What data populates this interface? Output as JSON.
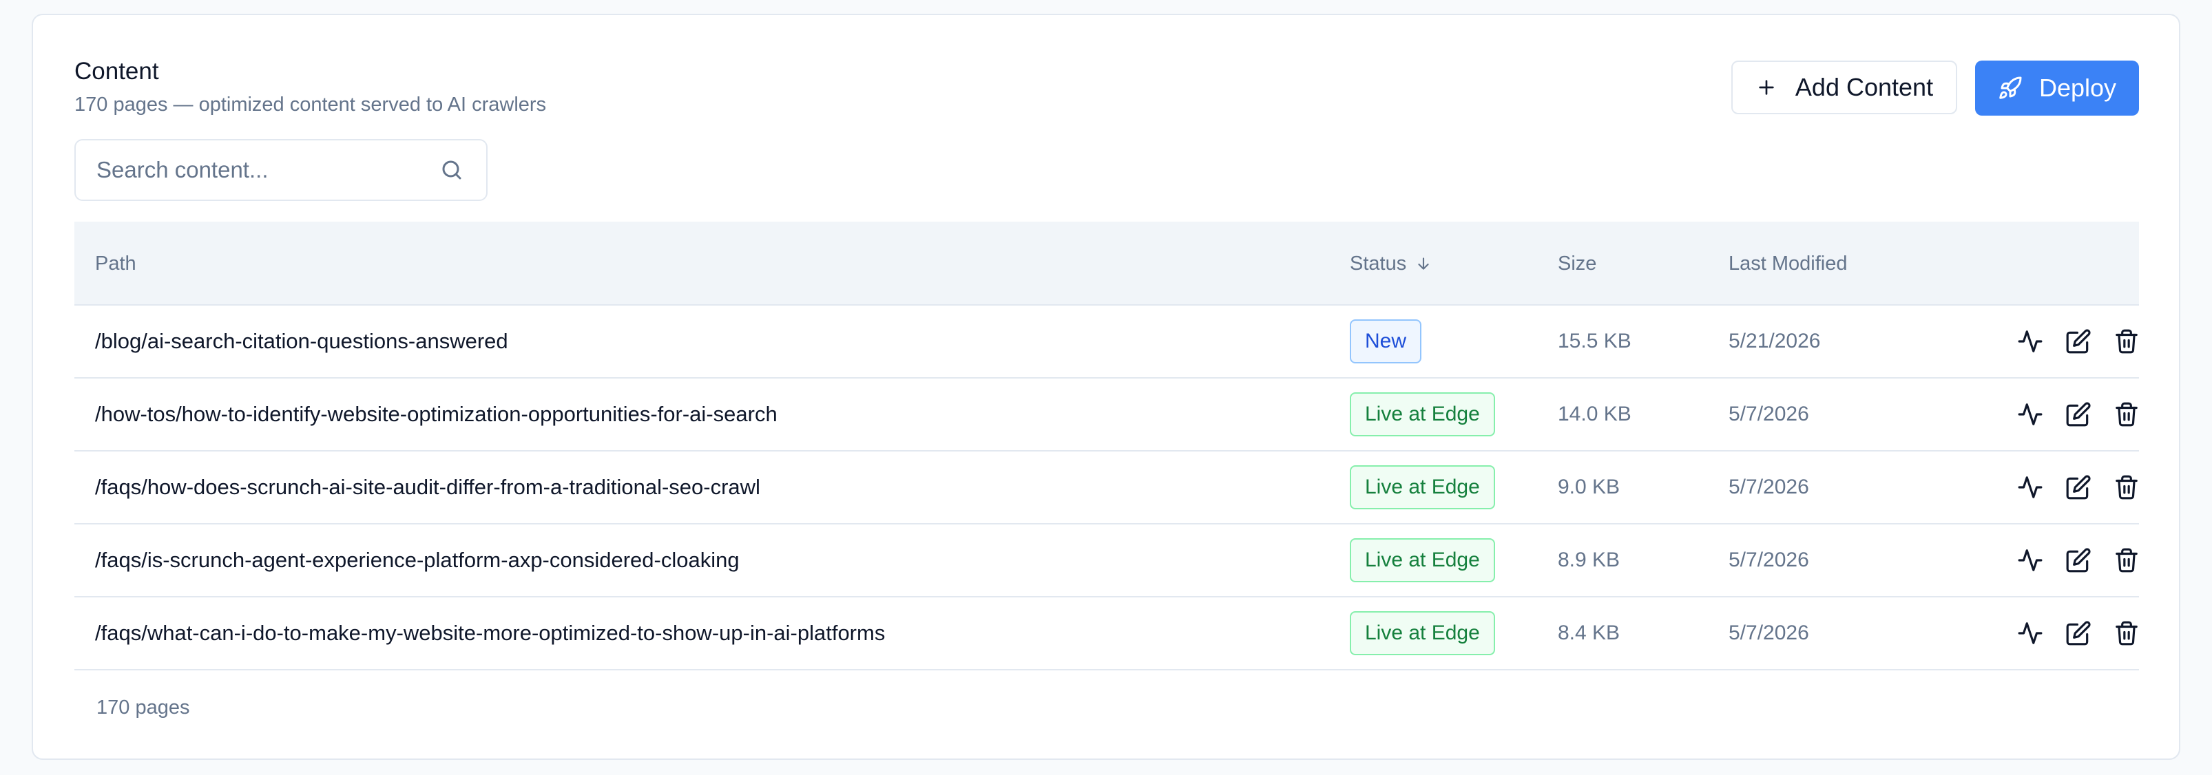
{
  "header": {
    "title": "Content",
    "subtitle": "170 pages — optimized content served to AI crawlers"
  },
  "actions": {
    "add_label": "Add Content",
    "deploy_label": "Deploy"
  },
  "search": {
    "placeholder": "Search content...",
    "value": ""
  },
  "table": {
    "columns": {
      "path": "Path",
      "status": "Status",
      "size": "Size",
      "modified": "Last Modified"
    },
    "sort": {
      "column": "status",
      "direction": "desc"
    },
    "rows": [
      {
        "path": "/blog/ai-search-citation-questions-answered",
        "status": "New",
        "size": "15.5 KB",
        "modified": "5/21/2026"
      },
      {
        "path": "/how-tos/how-to-identify-website-optimization-opportunities-for-ai-search",
        "status": "Live at Edge",
        "size": "14.0 KB",
        "modified": "5/7/2026"
      },
      {
        "path": "/faqs/how-does-scrunch-ai-site-audit-differ-from-a-traditional-seo-crawl",
        "status": "Live at Edge",
        "size": "9.0 KB",
        "modified": "5/7/2026"
      },
      {
        "path": "/faqs/is-scrunch-agent-experience-platform-axp-considered-cloaking",
        "status": "Live at Edge",
        "size": "8.9 KB",
        "modified": "5/7/2026"
      },
      {
        "path": "/faqs/what-can-i-do-to-make-my-website-more-optimized-to-show-up-in-ai-platforms",
        "status": "Live at Edge",
        "size": "8.4 KB",
        "modified": "5/7/2026"
      }
    ]
  },
  "footer": {
    "count_label": "170 pages"
  },
  "icons": {
    "add": "plus-icon",
    "deploy": "rocket-icon",
    "search": "search-icon",
    "sort": "arrow-down-icon",
    "row_actions": [
      "activity-icon",
      "edit-icon",
      "trash-icon"
    ]
  },
  "colors": {
    "accent": "#3b82f6",
    "new_badge": "#1d4ed8",
    "live_badge": "#15803d"
  }
}
